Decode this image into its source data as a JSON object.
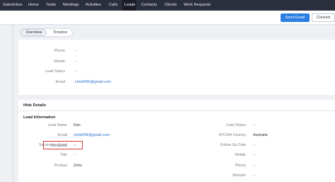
{
  "nav": {
    "items": [
      "SalesInbox",
      "Home",
      "Tasks",
      "Meetings",
      "Activities",
      "Calls",
      "Leads",
      "Contacts",
      "Clients",
      "Work Requests"
    ],
    "active": "Leads"
  },
  "actions": {
    "send_email": "Send Email",
    "convert": "Convert"
  },
  "tabs": {
    "overview": "Overview",
    "timeline": "Timeline"
  },
  "summary": {
    "phone_label": "Phone",
    "phone_value": "--",
    "mobile_label": "Mobile",
    "mobile_value": "--",
    "status_label": "Lead Status",
    "status_value": "--",
    "email_label": "Email",
    "email_value": "chrisf056@gmail.com"
  },
  "details": {
    "hide_label": "Hide Details",
    "section_title": "Lead Information",
    "left": [
      {
        "label": "Lead Name",
        "value": "Dan"
      },
      {
        "label": "Email",
        "value": "chrisf056@gmail.com"
      },
      {
        "label": "Secondary Email",
        "value": "--"
      },
      {
        "label": "Title",
        "value": "--"
      },
      {
        "label": "Company",
        "value": "--"
      },
      {
        "label": "Product",
        "value": "Zoho"
      }
    ],
    "right": [
      {
        "label": "Lead Status",
        "value": "--"
      },
      {
        "label": "ATCRM Country",
        "value": "Australia"
      },
      {
        "label": "Follow Up Date",
        "value": "--"
      },
      {
        "label": "Mobile",
        "value": "--"
      },
      {
        "label": "Phone",
        "value": "--"
      },
      {
        "label": "Website",
        "value": "--"
      }
    ]
  },
  "colors": {
    "nav_bg": "#2b2f3d",
    "primary": "#2a7de1",
    "link": "#2a6fd1",
    "highlight": "#d83a3a"
  }
}
